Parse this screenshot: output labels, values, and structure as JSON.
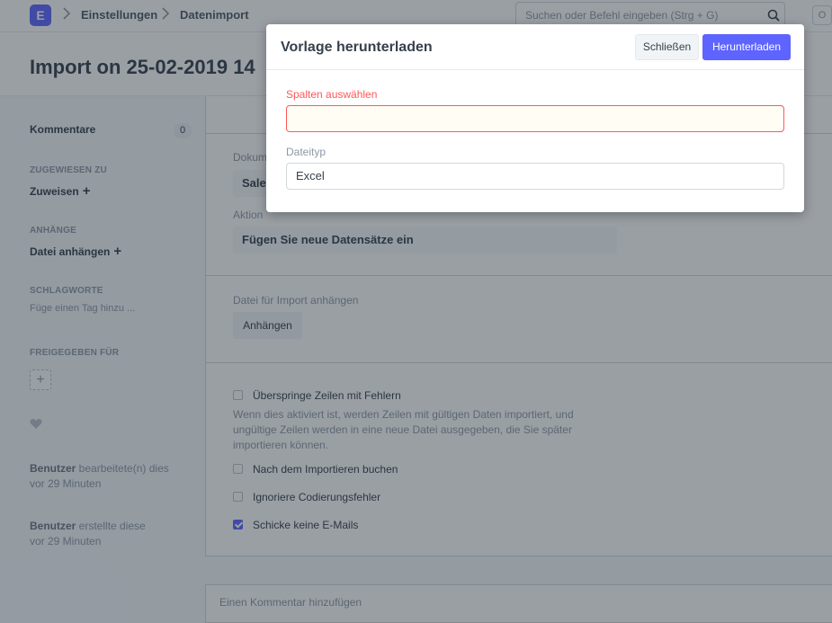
{
  "navbar": {
    "logo_letter": "E",
    "breadcrumbs": [
      "Einstellungen",
      "Datenimport"
    ],
    "search_placeholder": "Suchen oder Befehl eingeben (Strg + G)",
    "avatar_letter": "O"
  },
  "page": {
    "title": "Import on 25-02-2019 14"
  },
  "sidebar": {
    "comments_label": "Kommentare",
    "comments_count": "0",
    "assigned_label": "Zugewiesen zu",
    "assign_action": "Zuweisen",
    "attachments_label": "Anhänge",
    "attach_action": "Datei anhängen",
    "tags_label": "Schlagworte",
    "tags_placeholder": "Füge einen Tag hinzu ...",
    "shared_label": "Freigegeben für",
    "modified": {
      "user": "Benutzer",
      "text": " bearbeitete(n) dies",
      "time": "vor 29 Minuten"
    },
    "created": {
      "user": "Benutzer",
      "text": " erstellte diese",
      "time": "vor 29 Minuten"
    }
  },
  "form": {
    "doctype_label": "Dokum",
    "doctype_value": "Sale",
    "action_label": "Aktion",
    "action_value": "Fügen Sie neue Datensätze ein",
    "attach_label": "Datei für Import anhängen",
    "attach_button": "Anhängen",
    "checkboxes": [
      {
        "label": "Überspringe Zeilen mit Fehlern",
        "checked": false
      },
      {
        "label": "Nach dem Importieren buchen",
        "checked": false
      },
      {
        "label": "Ignoriere Codierungsfehler",
        "checked": false
      },
      {
        "label": "Schicke keine E-Mails",
        "checked": true
      }
    ],
    "skip_errors_help": "Wenn dies aktiviert ist, werden Zeilen mit gültigen Daten importiert, und ungültige Zeilen werden in eine neue Datei ausgegeben, die Sie später importieren können.",
    "comment_placeholder": "Einen Kommentar hinzufügen"
  },
  "modal": {
    "title": "Vorlage herunterladen",
    "close_button": "Schließen",
    "primary_button": "Herunterladen",
    "columns_label": "Spalten auswählen",
    "columns_value": "",
    "filetype_label": "Dateityp",
    "filetype_value": "Excel"
  },
  "colors": {
    "primary": "#5e64ff",
    "error": "#ff5858"
  }
}
